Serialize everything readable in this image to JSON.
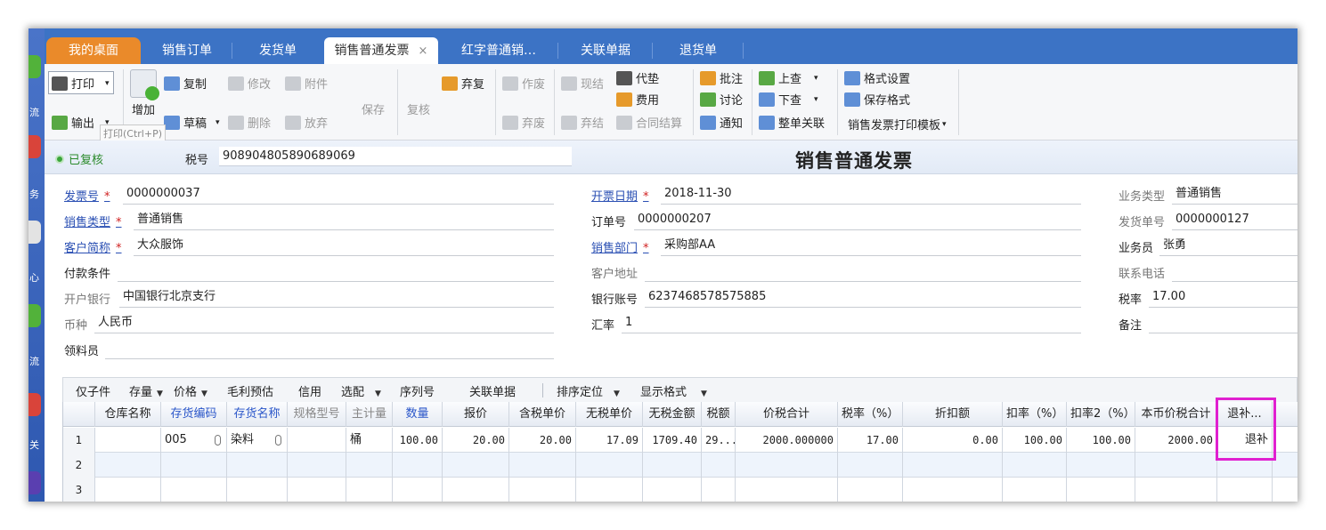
{
  "sidebar": {
    "labels": [
      "流",
      "务",
      "心",
      "流",
      "关"
    ]
  },
  "tabs": [
    {
      "label": "我的桌面"
    },
    {
      "label": "销售订单"
    },
    {
      "label": "发货单"
    },
    {
      "label": "销售普通发票",
      "close": "×"
    },
    {
      "label": "红字普通销…"
    },
    {
      "label": "关联单据"
    },
    {
      "label": "退货单"
    }
  ],
  "toolbar": {
    "print": "打印",
    "export": "输出",
    "add": "增加",
    "copy": "复制",
    "draft": "草稿",
    "modify": "修改",
    "delete": "删除",
    "attach": "附件",
    "abandon": "放弃",
    "save": "保存",
    "review": "复核",
    "reject": "弃复",
    "void": "作废",
    "discard": "弃废",
    "settle_now": "现结",
    "discard_settle": "弃结",
    "advance": "代垫",
    "expense": "费用",
    "contract_settle": "合同结算",
    "annotate": "批注",
    "discuss": "讨论",
    "notify": "通知",
    "look_up": "上查",
    "look_down": "下查",
    "link_all": "整单关联",
    "format_settings": "格式设置",
    "save_format": "保存格式",
    "print_template": "销售发票打印模板",
    "tooltip": "打印(Ctrl+P)"
  },
  "status": {
    "text": "已复核",
    "tax_label": "税号",
    "tax_value": "908904805890689069",
    "title": "销售普通发票"
  },
  "form": {
    "invoice_no_label": "发票号",
    "invoice_no": "0000000037",
    "sales_type_label": "销售类型",
    "sales_type": "普通销售",
    "customer_label": "客户简称",
    "customer": "大众服饰",
    "payment_label": "付款条件",
    "payment": "",
    "bank_label": "开户银行",
    "bank": "中国银行北京支行",
    "currency_label": "币种",
    "currency": "人民币",
    "receiver_label": "领料员",
    "receiver": "",
    "invoice_date_label": "开票日期",
    "invoice_date": "2018-11-30",
    "order_no_label": "订单号",
    "order_no": "0000000207",
    "dept_label": "销售部门",
    "dept": "采购部AA",
    "address_label": "客户地址",
    "address": "",
    "account_label": "银行账号",
    "account": "6237468578575885",
    "rate_label": "汇率",
    "rate": "1",
    "biz_type_label": "业务类型",
    "biz_type": "普通销售",
    "ship_no_label": "发货单号",
    "ship_no": "0000000127",
    "salesman_label": "业务员",
    "salesman": "张勇",
    "phone_label": "联系电话",
    "phone": "",
    "tax_rate_label": "税率",
    "tax_rate": "17.00",
    "remark_label": "备注",
    "remark": ""
  },
  "gridbar": {
    "only_child": "仅子件",
    "stock": "存量",
    "price": "价格",
    "profit": "毛利预估",
    "credit": "信用",
    "pick": "选配",
    "serial": "序列号",
    "linked": "关联单据",
    "sort": "排序定位",
    "display": "显示格式"
  },
  "grid": {
    "headers": [
      "仓库名称",
      "存货编码",
      "存货名称",
      "规格型号",
      "主计量",
      "数量",
      "报价",
      "含税单价",
      "无税单价",
      "无税金额",
      "税额",
      "价税合计",
      "税率（%）",
      "折扣额",
      "扣率（%）",
      "扣率2（%）",
      "本币价税合计",
      "退补..."
    ],
    "rows": [
      {
        "n": "1",
        "cells": [
          "",
          "005",
          "染料",
          "",
          "桶",
          "100.00",
          "20.00",
          "20.00",
          "17.09",
          "1709.40",
          "29...",
          "2000.000000",
          "17.00",
          "0.00",
          "100.00",
          "100.00",
          "2000.00",
          "退补"
        ]
      },
      {
        "n": "2",
        "cells": [
          "",
          "",
          "",
          "",
          "",
          "",
          "",
          "",
          "",
          "",
          "",
          "",
          "",
          "",
          "",
          "",
          "",
          ""
        ]
      },
      {
        "n": "3",
        "cells": [
          "",
          "",
          "",
          "",
          "",
          "",
          "",
          "",
          "",
          "",
          "",
          "",
          "",
          "",
          "",
          "",
          "",
          ""
        ]
      }
    ]
  }
}
